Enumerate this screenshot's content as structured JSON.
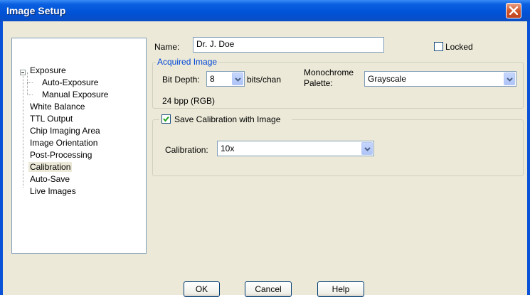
{
  "window": {
    "title": "Image Setup"
  },
  "tree": {
    "items": [
      {
        "label": "Exposure",
        "level": 0
      },
      {
        "label": "Auto-Exposure",
        "level": 1
      },
      {
        "label": "Manual Exposure",
        "level": 1
      },
      {
        "label": "White Balance",
        "level": 0
      },
      {
        "label": "TTL Output",
        "level": 0
      },
      {
        "label": "Chip Imaging Area",
        "level": 0
      },
      {
        "label": "Image Orientation",
        "level": 0
      },
      {
        "label": "Post-Processing",
        "level": 0
      },
      {
        "label": "Calibration",
        "level": 0,
        "selected": true
      },
      {
        "label": "Auto-Save",
        "level": 0
      },
      {
        "label": "Live Images",
        "level": 0
      }
    ]
  },
  "name": {
    "label": "Name:",
    "value": "Dr. J. Doe"
  },
  "locked": {
    "label": "Locked",
    "checked": false
  },
  "acquired": {
    "group_title": "Acquired Image",
    "bit_depth_label": "Bit Depth:",
    "bit_depth_value": "8",
    "bits_unit": "bits/chan",
    "palette_label_line1": "Monochrome",
    "palette_label_line2": "Palette:",
    "palette_value": "Grayscale",
    "bpp_text": "24 bpp (RGB)"
  },
  "calibration": {
    "save_label": "Save Calibration with Image",
    "save_checked": true,
    "label": "Calibration:",
    "value": "10x"
  },
  "buttons": {
    "ok": "OK",
    "cancel": "Cancel",
    "help": "Help"
  }
}
